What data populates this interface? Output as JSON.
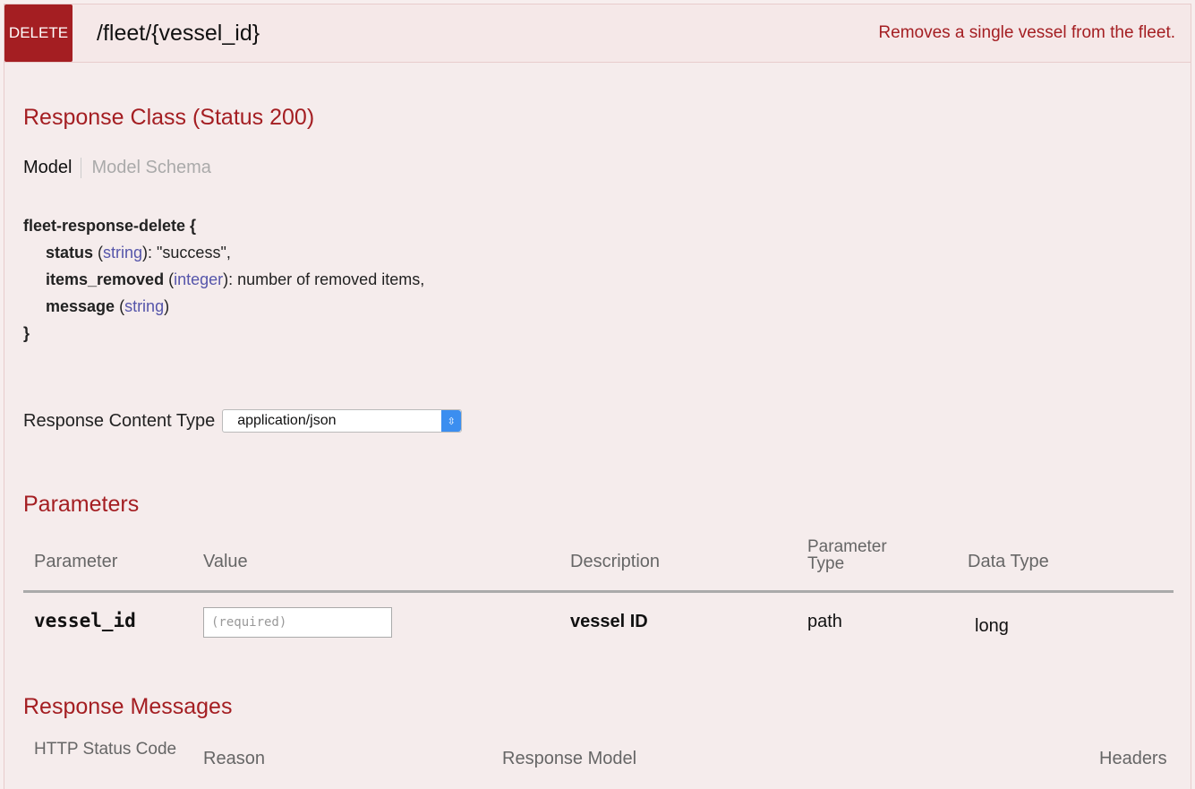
{
  "heading": {
    "method": "DELETE",
    "path": "/fleet/{vessel_id}",
    "summary": "Removes a single vessel from the fleet."
  },
  "response_class": {
    "title": "Response Class (Status 200)",
    "tabs": [
      "Model",
      "Model Schema"
    ],
    "model_name": "fleet-response-delete {",
    "properties": [
      {
        "name": "status",
        "type": "string",
        "desc": ": \"success\","
      },
      {
        "name": "items_removed",
        "type": "integer",
        "desc": ": number of removed items,"
      },
      {
        "name": "message",
        "type": "string",
        "desc": ""
      }
    ],
    "closing_brace": "}"
  },
  "response_content_type": {
    "label": "Response Content Type",
    "selected": "application/json"
  },
  "parameters": {
    "title": "Parameters",
    "headers": [
      "Parameter",
      "Value",
      "Description",
      "Parameter Type",
      "Data Type"
    ],
    "rows": [
      {
        "name": "vessel_id",
        "placeholder": "(required)",
        "description": "vessel ID",
        "param_type": "path",
        "data_type": "long"
      }
    ]
  },
  "response_messages": {
    "title": "Response Messages",
    "headers": [
      "HTTP Status Code",
      "Reason",
      "Response Model",
      "Headers"
    ]
  },
  "colors": {
    "accent": "#a41e22",
    "background": "#f5ecec",
    "type_link": "#5555aa",
    "select_arrow": "#3b8ef0"
  }
}
